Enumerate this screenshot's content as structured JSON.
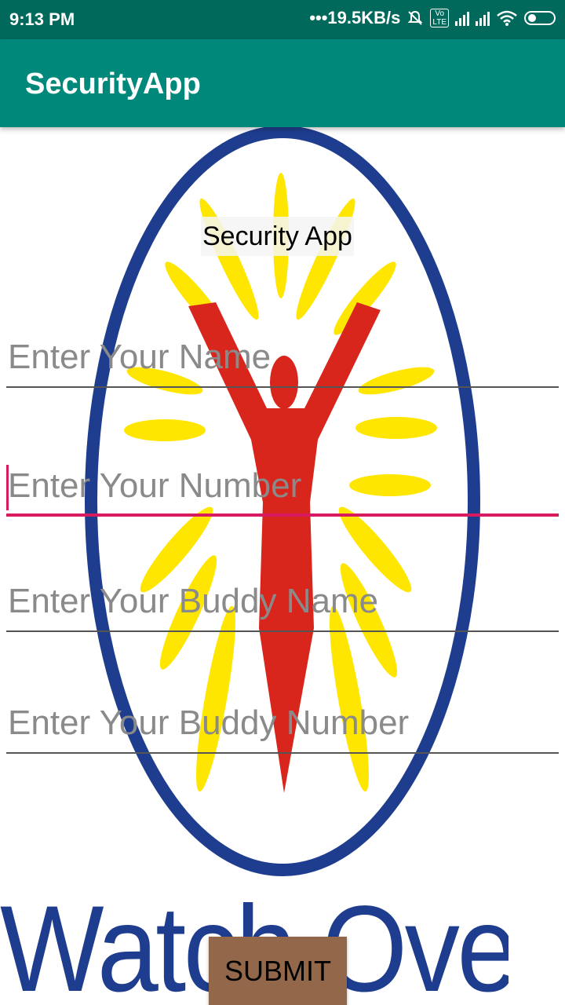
{
  "status_bar": {
    "time": "9:13 PM",
    "network_speed": "•••19.5KB/s",
    "icons": [
      "mute-bell-icon",
      "volte-icon",
      "signal-icon",
      "signal-icon",
      "wifi-icon",
      "battery-icon"
    ],
    "volte_label": "Vo\nLTE"
  },
  "app_bar": {
    "title": "SecurityApp"
  },
  "main": {
    "heading": "Security App",
    "fields": [
      {
        "placeholder": "Enter Your Name",
        "focused": false
      },
      {
        "placeholder": "Enter Your Number",
        "focused": true
      },
      {
        "placeholder": "Enter Your Buddy Name",
        "focused": false
      },
      {
        "placeholder": "Enter Your Buddy Number",
        "focused": false
      }
    ],
    "submit_label": "SUBMIT"
  },
  "background_logo": {
    "text": "Watch Over You",
    "colors": {
      "ring": "#1f3d8f",
      "figure": "#d9261c",
      "rays": "#ffe600"
    }
  },
  "colors": {
    "status_bar": "#00695c",
    "app_bar": "#00897b",
    "accent": "#d81b60",
    "submit_bg": "#93684a"
  }
}
